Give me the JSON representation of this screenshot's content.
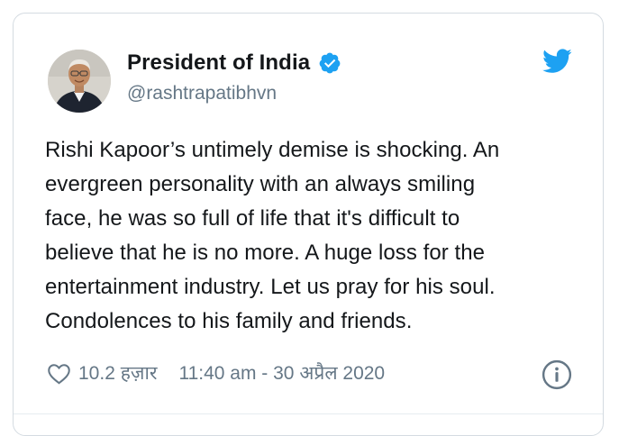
{
  "author": {
    "display_name": "President of India",
    "handle": "@rashtrapatibhvn",
    "verified": true
  },
  "tweet": {
    "text": "Rishi Kapoor’s untimely demise is shocking. An\nevergreen personality with an always smiling\nface, he was so full of life that it's difficult to\nbelieve that he is no more. A huge loss for the\nentertainment industry. Let us pray for his soul.\nCondolences to his family and friends."
  },
  "footer": {
    "likes": "10.2 हज़ार",
    "timestamp": "11:40 am - 30 अप्रैल 2020"
  },
  "icons": {
    "brand": "twitter-bird-icon",
    "verified": "verified-badge-icon",
    "like": "heart-icon",
    "info": "info-icon"
  },
  "colors": {
    "brand_blue": "#1da1f2",
    "text": "#14171a",
    "muted": "#657786",
    "border": "#d4dbe1"
  }
}
